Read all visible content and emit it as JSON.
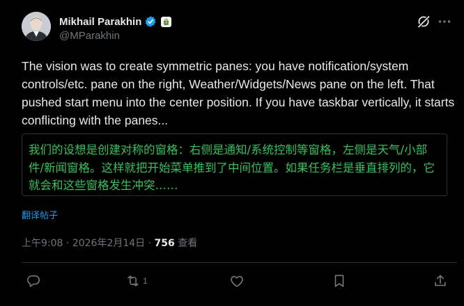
{
  "colors": {
    "background": "#000000",
    "text": "#e7e9ea",
    "secondary": "#71767b",
    "accent": "#1d9bf0",
    "translation": "#36c15a",
    "verified": "#1d9bf0"
  },
  "author": {
    "name": "Mikhail Parakhin",
    "handle": "@MParakhin",
    "avatar_icon": "user-avatar-photo",
    "verified_icon": "verified-badge-icon",
    "affiliation_icon": "shopify-bag-icon"
  },
  "header_icons": [
    "grok-icon",
    "more-options-icon"
  ],
  "tweet": {
    "text": "The vision was to create symmetric panes: you have notification/system controls/etc. pane on the right, Weather/Widgets/News pane on the left. That pushed start menu into the center position. If you have taskbar vertically, it starts conflicting with the panes...",
    "translation": "我们的设想是创建对称的窗格：右侧是通知/系统控制等窗格，左侧是天气/小部件/新闻窗格。这样就把开始菜单推到了中间位置。如果任务栏是垂直排列的，它就会和这些窗格发生冲突……",
    "translate_link": "翻译帖子"
  },
  "meta": {
    "time": "上午9:08",
    "separator": " · ",
    "date": "2026年2月14日",
    "sep2": " · ",
    "views_count": "756",
    "views_label": " 查看"
  },
  "actions": [
    {
      "icon": "reply-icon",
      "count": ""
    },
    {
      "icon": "repost-icon",
      "count": "1"
    },
    {
      "icon": "like-icon",
      "count": ""
    },
    {
      "icon": "bookmark-icon",
      "count": ""
    },
    {
      "icon": "share-icon",
      "count": ""
    }
  ]
}
